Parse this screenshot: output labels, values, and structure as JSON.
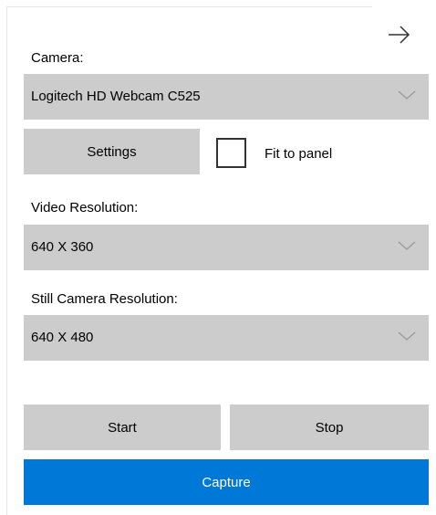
{
  "panel": {
    "collapse_icon": "arrow-right-icon"
  },
  "camera": {
    "label": "Camera:",
    "selected": "Logitech HD Webcam C525",
    "chevron_icon": "chevron-down-icon"
  },
  "settings": {
    "button_label": "Settings",
    "fit_to_panel_label": "Fit to panel",
    "fit_to_panel_checked": false
  },
  "video_resolution": {
    "label": "Video Resolution:",
    "selected": "640 X 360"
  },
  "still_resolution": {
    "label": "Still Camera Resolution:",
    "selected": "640 X 480"
  },
  "actions": {
    "start_label": "Start",
    "stop_label": "Stop",
    "capture_label": "Capture"
  },
  "colors": {
    "accent": "#0078d7",
    "control_bg": "#cccccc"
  }
}
